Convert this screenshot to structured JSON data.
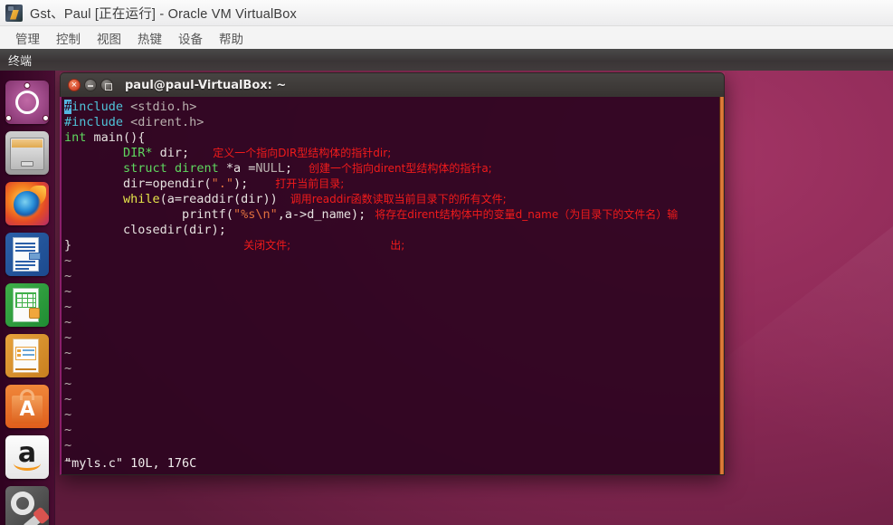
{
  "vbox": {
    "title": "Gst、Paul [正在运行] - Oracle VM VirtualBox",
    "app_icon": "virtualbox-icon",
    "menu": [
      {
        "label": "管理"
      },
      {
        "label": "控制"
      },
      {
        "label": "视图"
      },
      {
        "label": "热键"
      },
      {
        "label": "设备"
      },
      {
        "label": "帮助"
      }
    ]
  },
  "unity": {
    "panel_title": "终端",
    "launcher": [
      {
        "name": "ubuntu-dash",
        "label": "Dash"
      },
      {
        "name": "files",
        "label": "Files"
      },
      {
        "name": "firefox",
        "label": "Firefox"
      },
      {
        "name": "libreoffice-writer",
        "label": "LibreOffice Writer"
      },
      {
        "name": "libreoffice-calc",
        "label": "LibreOffice Calc"
      },
      {
        "name": "libreoffice-impress",
        "label": "LibreOffice Impress"
      },
      {
        "name": "ubuntu-software-center",
        "label": "Ubuntu Software Center"
      },
      {
        "name": "amazon",
        "label": "Amazon"
      },
      {
        "name": "system-settings",
        "label": "System Settings"
      }
    ]
  },
  "terminal": {
    "title": "paul@paul-VirtualBox: ~",
    "buttons": {
      "close": "close-button",
      "minimize": "minimize-button",
      "maximize": "maximize-button"
    },
    "status": "\"myls.c\" 10L, 176C",
    "tilde_count": 14,
    "code": {
      "l1_cursor": "#",
      "l1_pre": "include",
      "l1_hdr": " <stdio.h>",
      "l2_pre": "#include",
      "l2_hdr": " <dirent.h>",
      "l3_type": "int",
      "l3_rest": " main(){",
      "l4_indent": "        ",
      "l4_type": "DIR*",
      "l4_rest": " dir;",
      "l4_note": "定义一个指向DIR型结构体的指针dir;",
      "l5_indent": "        ",
      "l5_kw": "struct",
      "l5_type": " dirent",
      "l5_rest": " *a =",
      "l5_null": "NULL",
      "l5_semi": ";",
      "l5_note": "创建一个指向dirent型结构体的指针a;",
      "l6_indent": "        ",
      "l6_code": "dir=opendir(",
      "l6_str": "\".\"",
      "l6_end": ");",
      "l6_note": "打开当前目录;",
      "l7_indent": "        ",
      "l7_kw": "while",
      "l7_rest": "(a=readdir(dir))",
      "l7_note": "调用readdir函数读取当前目录下的所有文件;",
      "l8_indent": "                ",
      "l8_code": "printf(",
      "l8_str": "\"%s\\n\"",
      "l8_end": ",a->d_name);",
      "l8_note": "将存在dirent结构体中的变量d_name（为目录下的文件名）输",
      "l9_indent": "        ",
      "l9_code": "closedir(dir);",
      "l10_code": "}",
      "l10_note_a": "关闭文件;",
      "l10_note_b": "出;",
      "tilde": "~"
    }
  },
  "colors": {
    "accent_orange": "#e8863f",
    "terminal_bg": "#2d0420",
    "annotation_red": "#f11b1b",
    "wallpaper": "#8e2a57"
  }
}
